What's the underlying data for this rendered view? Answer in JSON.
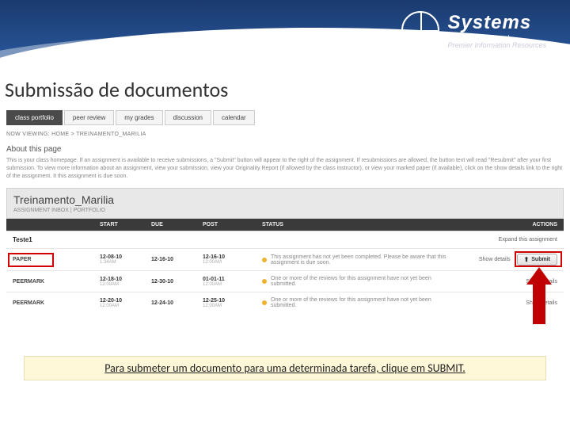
{
  "logo": {
    "main": "Systems",
    "sub1": "Link International",
    "sub2": "Premier Information Resources"
  },
  "page_title": "Submissão de documentos",
  "tabs": [
    "class portfolio",
    "peer review",
    "my grades",
    "discussion",
    "calendar"
  ],
  "breadcrumb": "NOW VIEWING: HOME > TREINAMENTO_MARILIA",
  "about": {
    "heading": "About this page",
    "text": "This is your class homepage. If an assignment is available to receive submissions, a \"Submit\" button will appear to the right of the assignment. If resubmissions are allowed, the button text will read \"Resubmit\" after your first submission. To view more information about an assignment, view your submission, view your Originality Report (if allowed by the class instructor), or view your marked paper (if available), click on the show details link to the right of the assignment. It this assignment is due soon."
  },
  "class": {
    "title": "Treinamento_Marilia",
    "sub": "ASSIGNMENT INBOX | PORTFOLIO"
  },
  "table_headers": {
    "start": "START",
    "due": "DUE",
    "post": "POST",
    "status": "STATUS",
    "actions": "ACTIONS"
  },
  "assignment": {
    "name": "Teste1",
    "expand": "Expand this assignment"
  },
  "rows": [
    {
      "type": "PAPER",
      "start_d": "12-08-10",
      "start_t": "1:34AM",
      "due_d": "12-16-10",
      "due_t": "",
      "post_d": "12-16-10",
      "post_t": "12:00AM",
      "status": "This assignment has not yet been completed. Please be aware that this assignment is due soon.",
      "details": "Show details",
      "submit": "Submit"
    },
    {
      "type": "PEERMARK",
      "start_d": "12-18-10",
      "start_t": "12:00AM",
      "due_d": "12-30-10",
      "due_t": "",
      "post_d": "01-01-11",
      "post_t": "12:00AM",
      "status": "One or more of the reviews for this assignment have not yet been submitted.",
      "details": "Show details"
    },
    {
      "type": "PEERMARK",
      "start_d": "12-20-10",
      "start_t": "12:00AM",
      "due_d": "12-24-10",
      "due_t": "",
      "post_d": "12-25-10",
      "post_t": "12:00AM",
      "status": "One or more of the reviews for this assignment have not yet been submitted.",
      "details": "Show details"
    }
  ],
  "caption": "Para submeter um documento para uma determinada tarefa, clique em SUBMIT."
}
